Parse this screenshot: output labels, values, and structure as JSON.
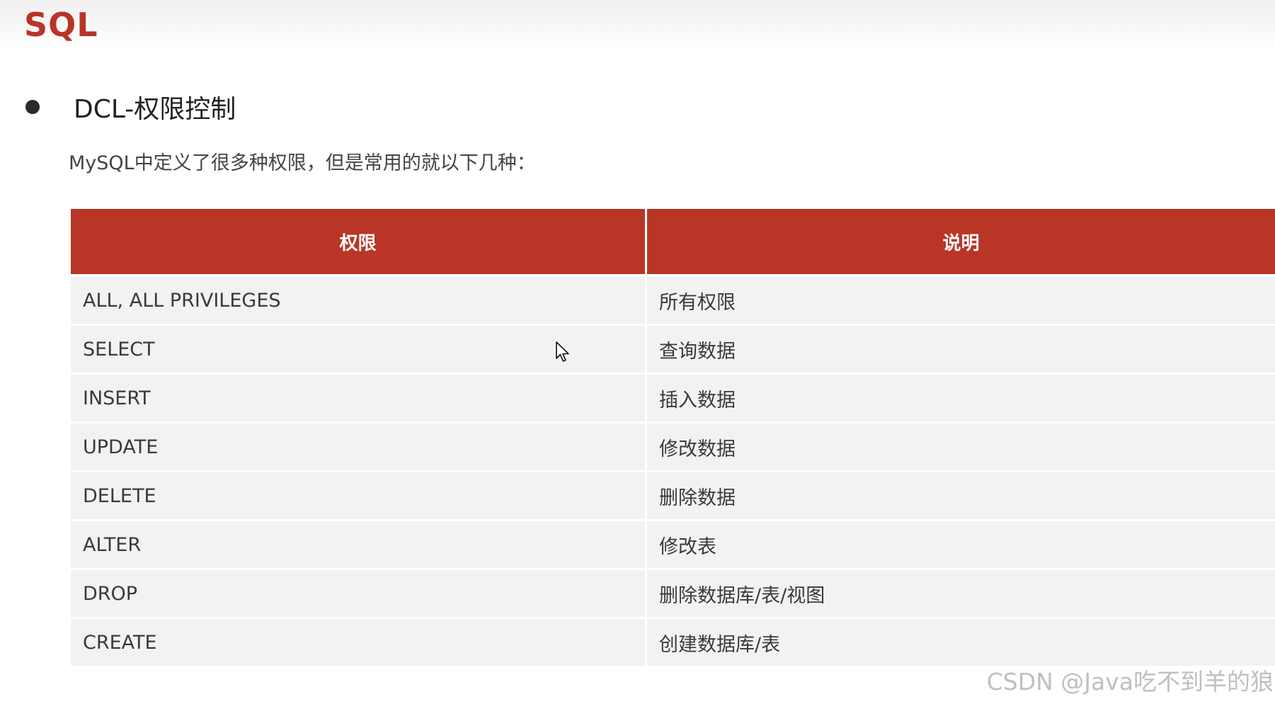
{
  "header": {
    "brand": "SQL"
  },
  "section": {
    "title": "DCL-权限控制",
    "intro": "MySQL中定义了很多种权限，但是常用的就以下几种："
  },
  "table": {
    "headers": [
      "权限",
      "说明"
    ],
    "rows": [
      [
        "ALL, ALL PRIVILEGES",
        "所有权限"
      ],
      [
        "SELECT",
        "查询数据"
      ],
      [
        "INSERT",
        "插入数据"
      ],
      [
        "UPDATE",
        "修改数据"
      ],
      [
        "DELETE",
        "删除数据"
      ],
      [
        "ALTER",
        "修改表"
      ],
      [
        "DROP",
        "删除数据库/表/视图"
      ],
      [
        "CREATE",
        "创建数据库/表"
      ]
    ]
  },
  "watermark": "CSDN @Java吃不到羊的狼",
  "colors": {
    "accent": "#b93526",
    "row_bg": "#f2f2f2",
    "text": "#3a3a3a"
  },
  "icons": {
    "cursor": "mouse-pointer-icon",
    "bullet": "bullet-dot-icon"
  }
}
